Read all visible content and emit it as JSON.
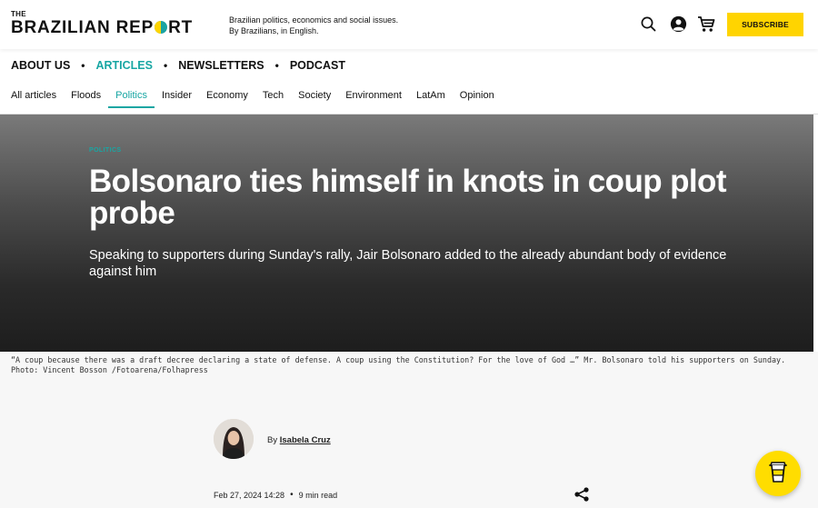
{
  "header": {
    "logo_small": "THE",
    "logo_part1": "BRAZILIAN REP",
    "logo_part2": "RT",
    "tagline_line1": "Brazilian politics, economics and social issues.",
    "tagline_line2": "By Brazilians, in English.",
    "subscribe_label": "SUBSCRIBE",
    "icons": [
      "search-icon",
      "account-icon",
      "cart-icon"
    ]
  },
  "nav_primary": {
    "items": [
      {
        "label": "ABOUT US"
      },
      {
        "label": "ARTICLES"
      },
      {
        "label": "NEWSLETTERS"
      },
      {
        "label": "PODCAST"
      }
    ],
    "separator": "•",
    "active_index": 1
  },
  "nav_categories": {
    "items": [
      {
        "label": "All articles"
      },
      {
        "label": "Floods"
      },
      {
        "label": "Politics"
      },
      {
        "label": "Insider"
      },
      {
        "label": "Economy"
      },
      {
        "label": "Tech"
      },
      {
        "label": "Society"
      },
      {
        "label": "Environment"
      },
      {
        "label": "LatAm"
      },
      {
        "label": "Opinion"
      }
    ],
    "active_index": 2
  },
  "article": {
    "kicker": "POLITICS",
    "title": "Bolsonaro ties himself in knots in coup plot probe",
    "subtitle": "Speaking to supporters during Sunday's rally, Jair Bolsonaro added to the already abundant body of evidence against him",
    "caption": "“A coup because there was a draft decree declaring a state of defense. A coup using the Constitution? For the love of God …” Mr. Bolsonaro told his supporters on Sunday. Photo: Vincent Bosson /Fotoarena/Folhapress",
    "byline_prefix": "By",
    "author": "Isabela Cruz",
    "date": "Feb 27, 2024 14:28",
    "meta_separator": "•",
    "read_time": "9 min read"
  },
  "colors": {
    "accent": "#18a6a3",
    "subscribe": "#ffd400",
    "coffee_button": "#ffdd00"
  }
}
